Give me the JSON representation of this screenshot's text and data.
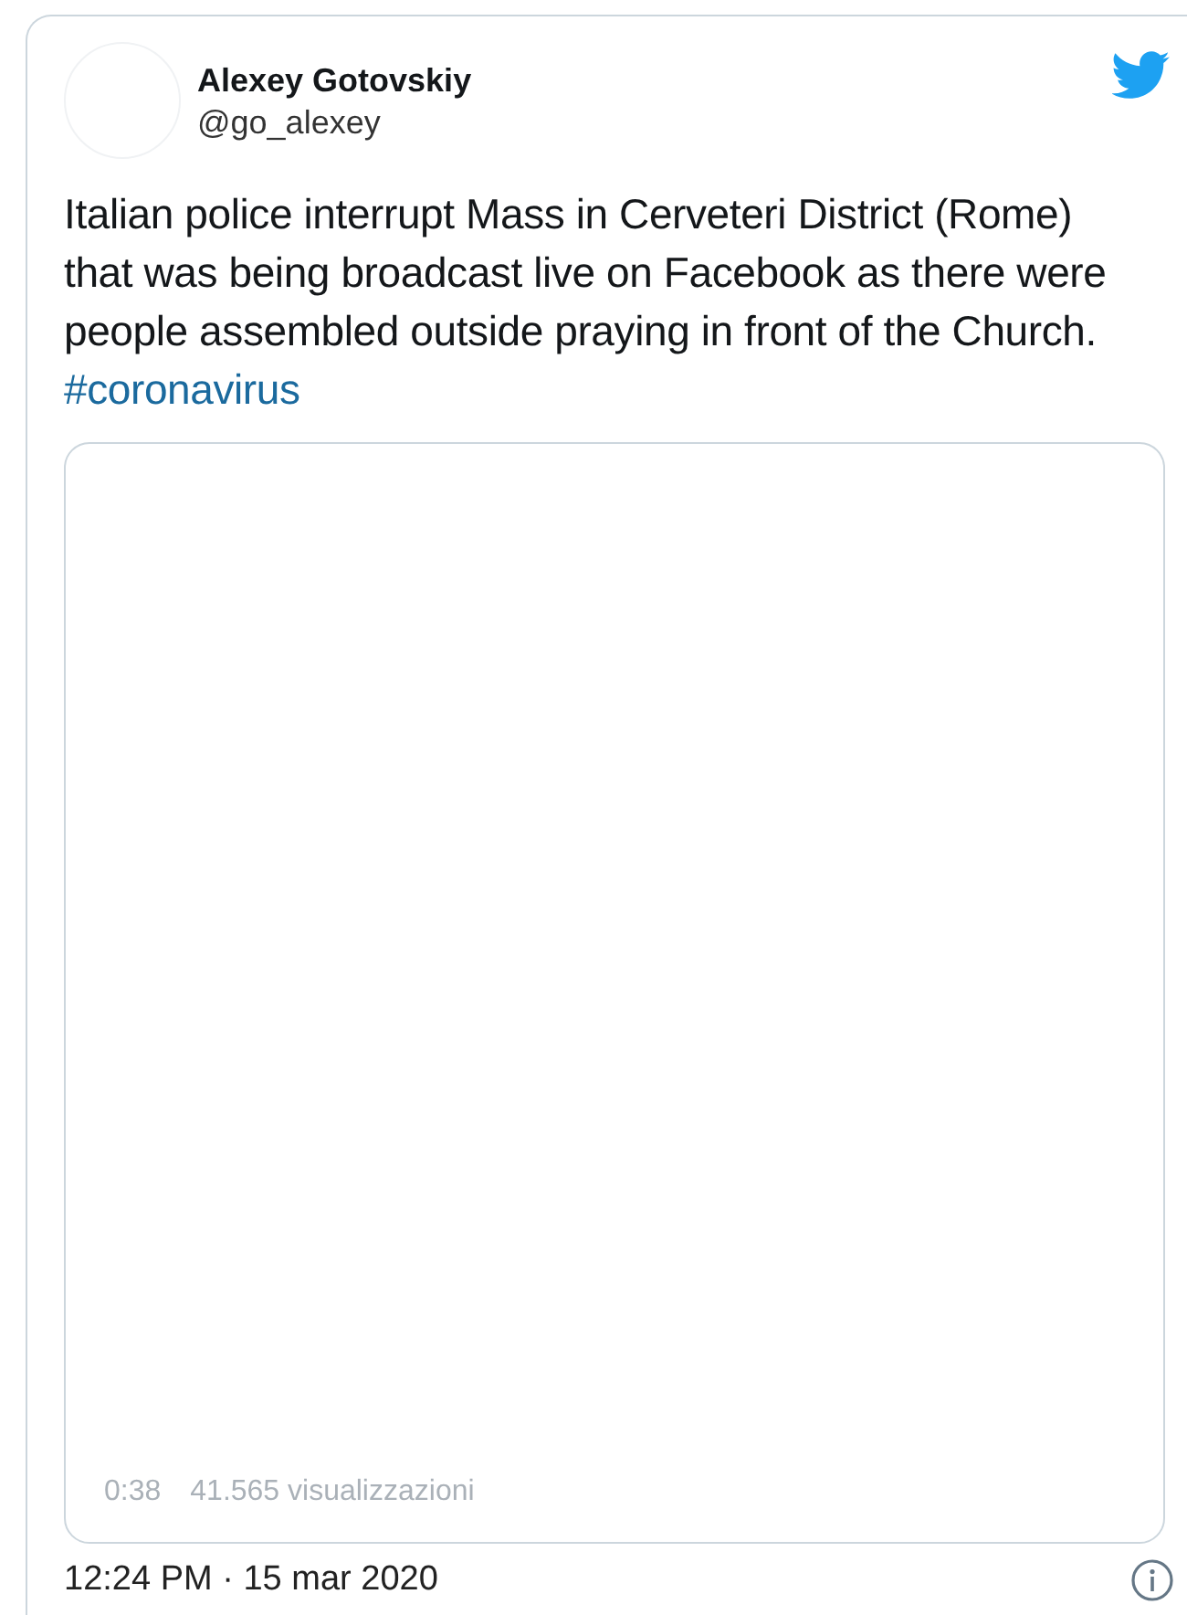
{
  "tweet": {
    "author_name": "Alexey Gotovskiy",
    "handle": "@go_alexey",
    "text": "Italian police interrupt Mass in Cerveteri District (Rome) that was being broadcast live on Facebook as there were people assembled outside praying in front of the Church.",
    "hashtag": "#coronavirus",
    "video": {
      "duration": "0:38",
      "views": "41.565 visualizzazioni"
    },
    "timestamp": "12:24 PM · 15 mar 2020"
  }
}
